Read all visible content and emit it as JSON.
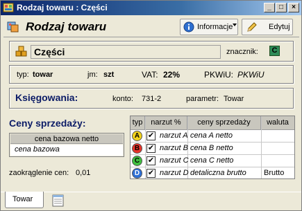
{
  "window": {
    "title": "Rodzaj towaru : Części",
    "controls": {
      "minimize": "_",
      "maximize": "□",
      "close": "×"
    }
  },
  "header": {
    "title": "Rodzaj towaru",
    "info_button": "Informacje",
    "edit_button": "Edytuj"
  },
  "item": {
    "name": "Części",
    "marker_label": "znacznik:",
    "marker_value": "C",
    "marker_color": "#2e8b57"
  },
  "details": {
    "type_label": "typ:",
    "type_value": "towar",
    "unit_label": "jm:",
    "unit_value": "szt",
    "vat_label": "VAT:",
    "vat_value": "22%",
    "pkwiu_label": "PKWiU:",
    "pkwiu_value": "PKWiU"
  },
  "accounting": {
    "title": "Księgowania:",
    "account_label": "konto:",
    "account_value": "731-2",
    "param_label": "parametr:",
    "param_value": "Towar"
  },
  "prices": {
    "title": "Ceny sprzedaży:",
    "base_header": "cena bazowa netto",
    "base_value": "cena bazowa",
    "rounding_label": "zaokrąglenie cen:",
    "rounding_value": "0,01",
    "columns": [
      "typ",
      "narzut %",
      "ceny sprzedaży",
      "waluta"
    ],
    "rows": [
      {
        "type": "A",
        "color": "#f2d21b",
        "markup": "narzut A",
        "price": "cena A netto",
        "currency": ""
      },
      {
        "type": "B",
        "color": "#e8332a",
        "markup": "narzut B",
        "price": "cena B netto",
        "currency": ""
      },
      {
        "type": "C",
        "color": "#3fbf3f",
        "markup": "narzut C",
        "price": "cena C netto",
        "currency": ""
      },
      {
        "type": "D",
        "color": "#2f6fd6",
        "markup": "narzut D",
        "price": "detaliczna brutto",
        "currency": "Brutto"
      }
    ]
  },
  "tabs": {
    "active": "Towar"
  }
}
